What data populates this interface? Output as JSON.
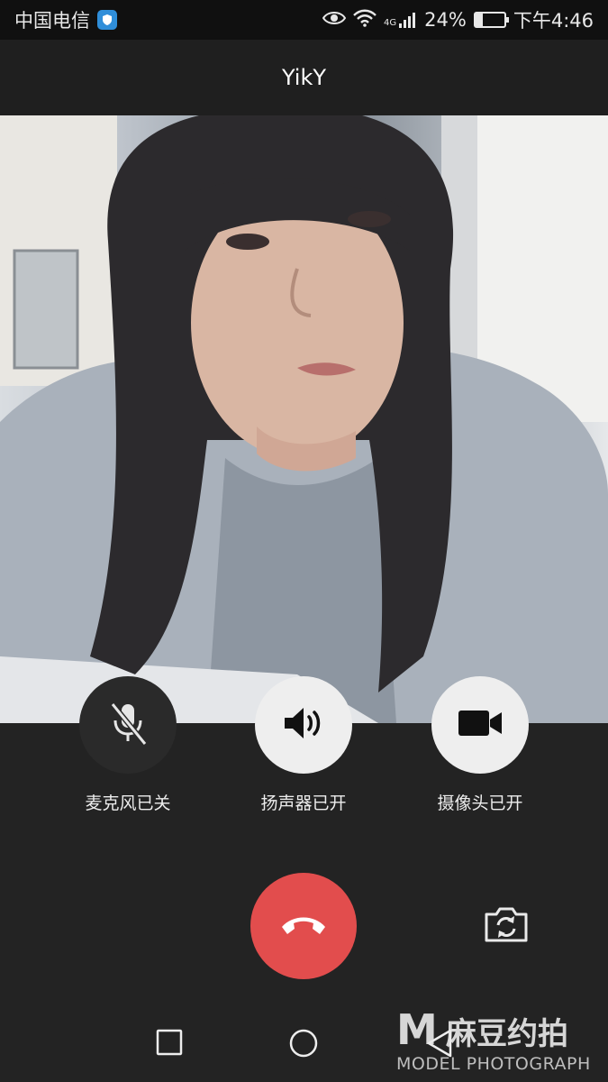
{
  "status": {
    "carrier": "中国电信",
    "network": "4G",
    "battery": "24%",
    "battery_level": 0.24,
    "time": "下午4:46",
    "icons": [
      "shield-icon",
      "eye-icon",
      "wifi-icon",
      "signal-icon",
      "battery-icon"
    ]
  },
  "header": {
    "title": "YikY"
  },
  "controls": {
    "mic_label": "麦克风已关",
    "speaker_label": "扬声器已开",
    "camera_label": "摄像头已开"
  },
  "colors": {
    "hangup": "#e24d4d",
    "background": "#232323",
    "button_on": "#eeeeee",
    "button_off": "#2a2a2a"
  },
  "watermark": {
    "letter": "M",
    "cn": "麻豆约拍",
    "en": "MODEL PHOTOGRAPH"
  }
}
